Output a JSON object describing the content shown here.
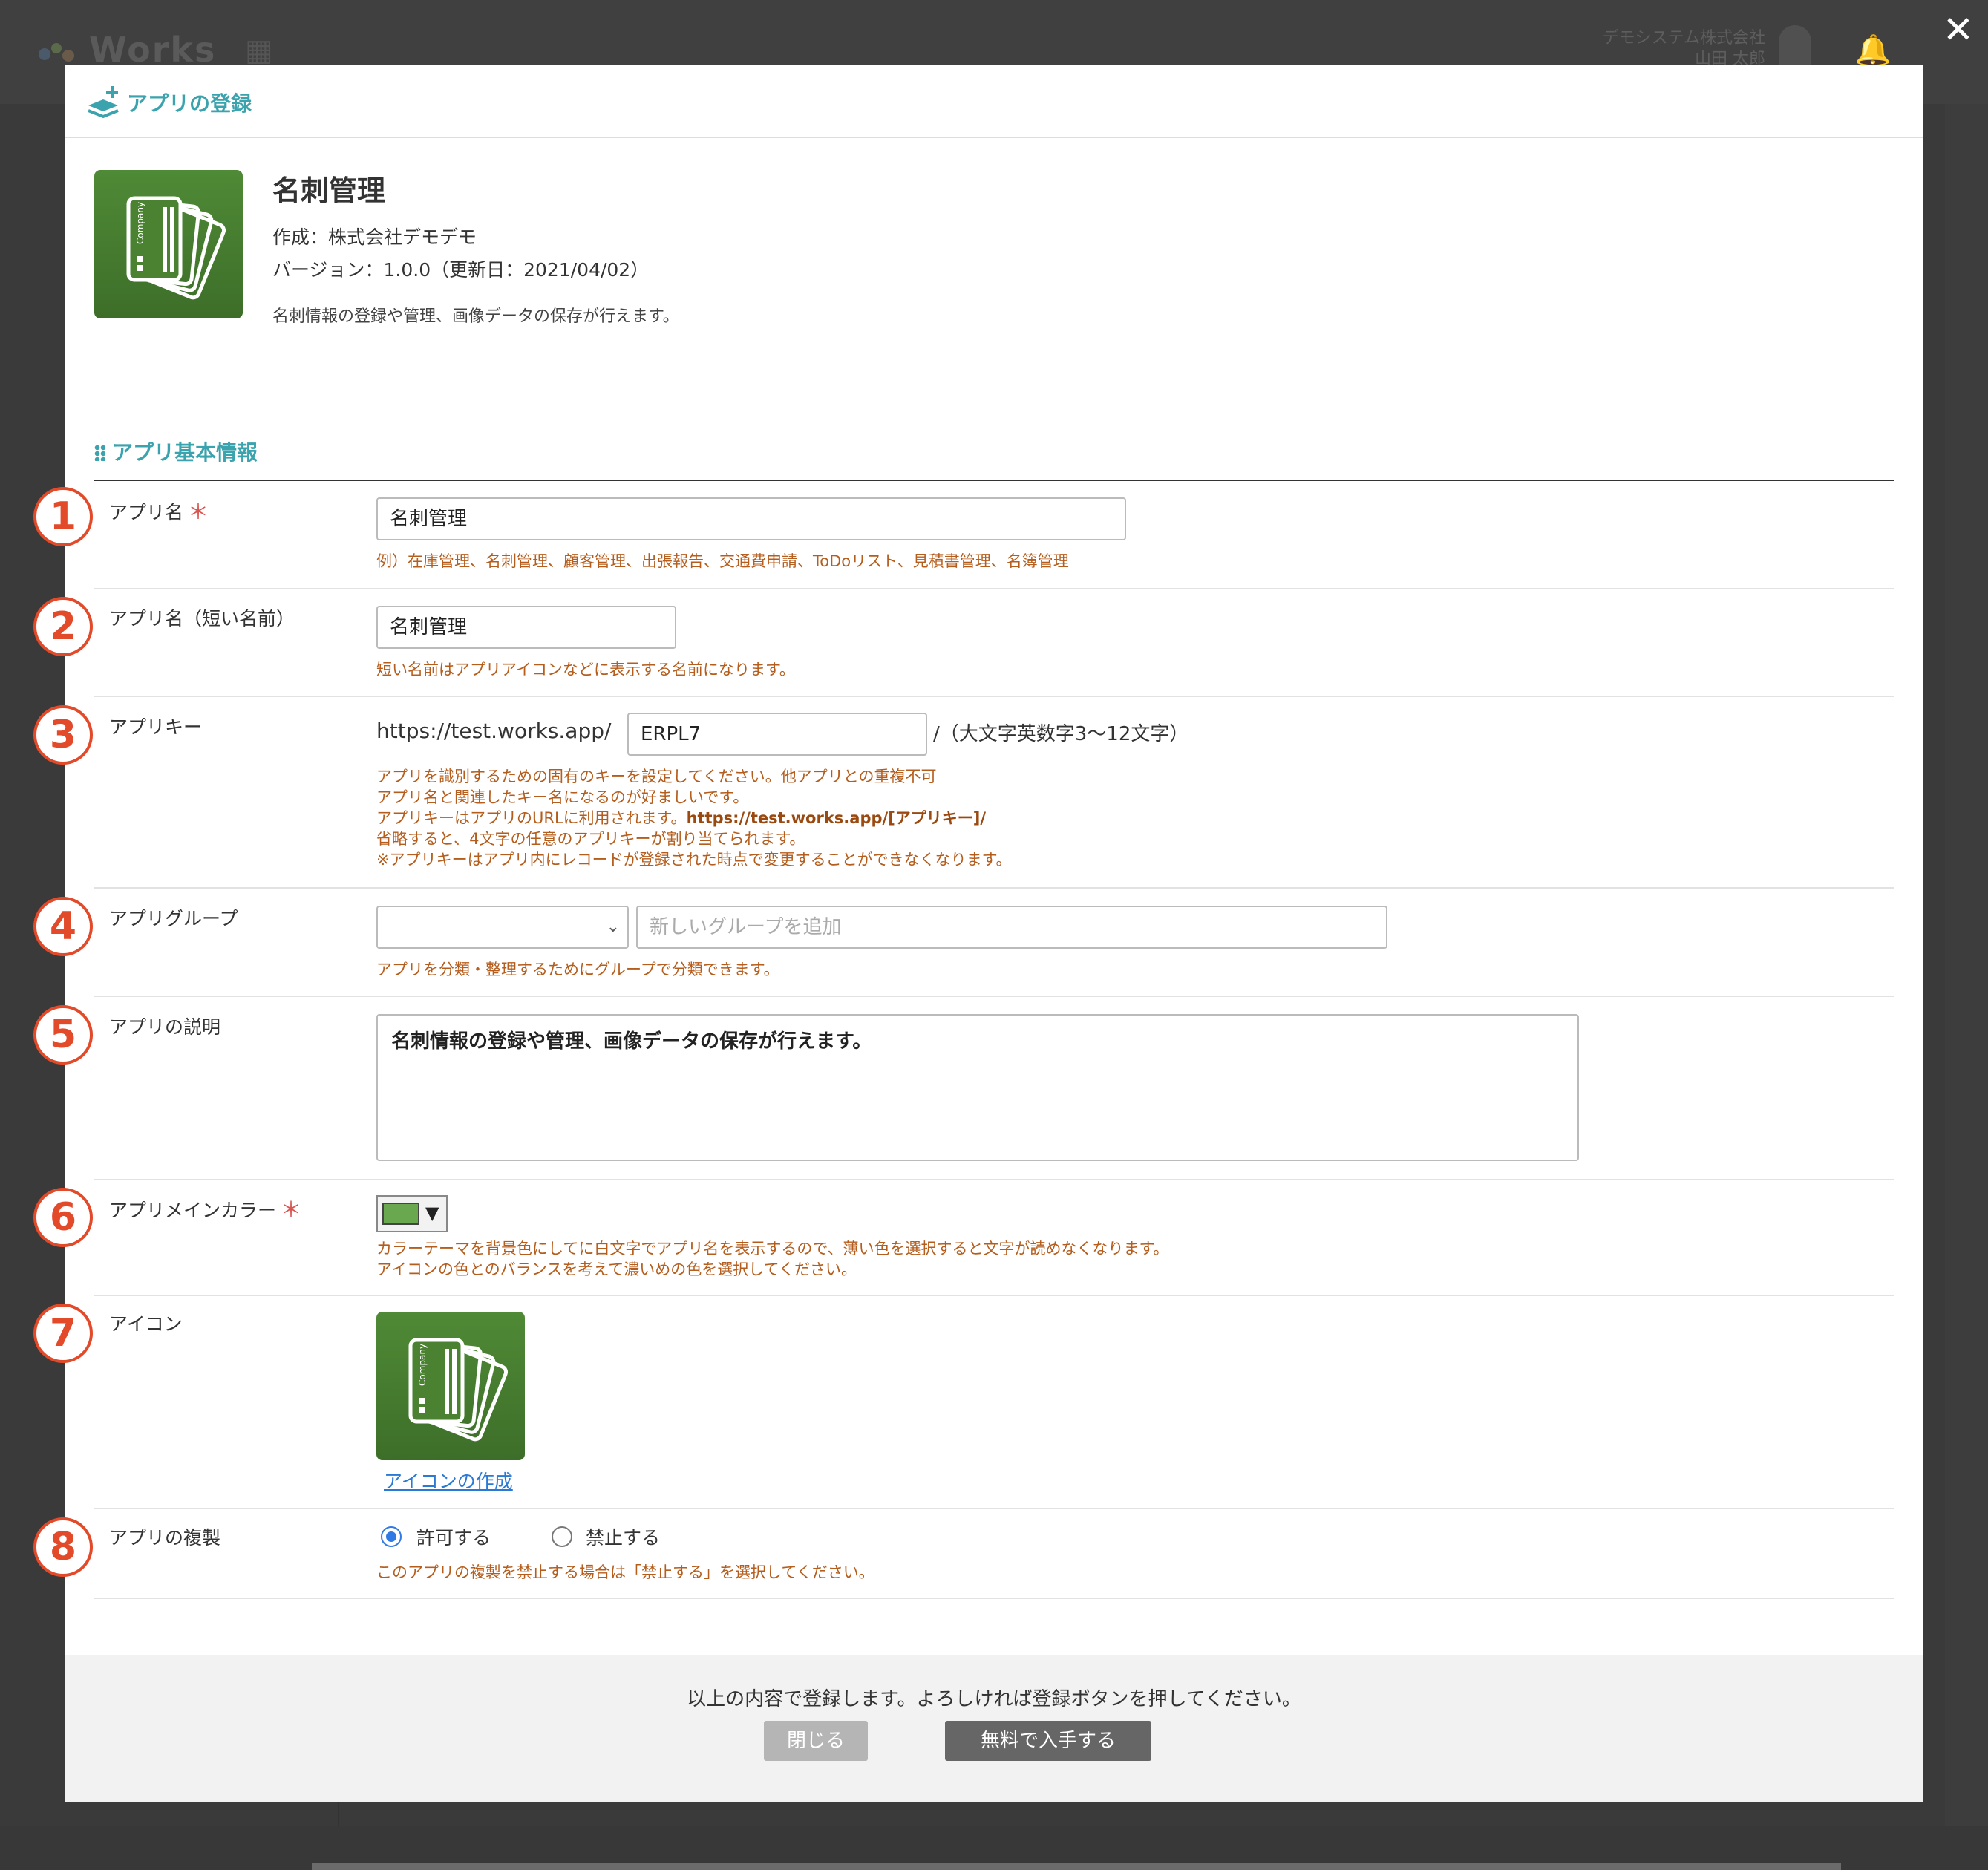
{
  "background": {
    "logo_text": "Works",
    "company_name": "デモシステム株式会社",
    "user_name": "山田 太郎"
  },
  "modal": {
    "title": "アプリの登録",
    "close_label": "✕"
  },
  "app": {
    "name": "名刺管理",
    "author": "作成：株式会社デモデモ",
    "version": "バージョン：1.0.0（更新日：2021/04/02）",
    "description": "名刺情報の登録や管理、画像データの保存が行えます。",
    "icon_color": "#4f8a36"
  },
  "section": {
    "title": "アプリ基本情報"
  },
  "fields": {
    "app_name": {
      "badge": "1",
      "label": "アプリ名",
      "required_mark": "＊",
      "value": "名刺管理",
      "hint": "例）在庫管理、名刺管理、顧客管理、出張報告、交通費申請、ToDoリスト、見積書管理、名簿管理"
    },
    "short_name": {
      "badge": "2",
      "label": "アプリ名（短い名前）",
      "value": "名刺管理",
      "hint": "短い名前はアプリアイコンなどに表示する名前になります。"
    },
    "app_key": {
      "badge": "3",
      "label": "アプリキー",
      "url_prefix": "https://test.works.app/",
      "value": "ERPL7",
      "suffix": "/（大文字英数字3〜12文字）",
      "hint_lines": [
        "アプリを識別するための固有のキーを設定してください。他アプリとの重複不可",
        "アプリ名と関連したキー名になるのが好ましいです。",
        "アプリキーはアプリのURLに利用されます。",
        "https://test.works.app/[アプリキー]/",
        "省略すると、4文字の任意のアプリキーが割り当てられます。",
        "※アプリキーはアプリ内にレコードが登録された時点で変更することができなくなります。"
      ]
    },
    "app_group": {
      "badge": "4",
      "label": "アプリグループ",
      "select_value": "",
      "new_group_placeholder": "新しいグループを追加",
      "hint": "アプリを分類・整理するためにグループで分類できます。"
    },
    "description": {
      "badge": "5",
      "label": "アプリの説明",
      "value": "名刺情報の登録や管理、画像データの保存が行えます。"
    },
    "main_color": {
      "badge": "6",
      "label": "アプリメインカラー",
      "required_mark": "＊",
      "color": "#6aa84f",
      "caret": "▼",
      "hint_lines": [
        "カラーテーマを背景色にしてに白文字でアプリ名を表示するので、薄い色を選択すると文字が読めなくなります。",
        "アイコンの色とのバランスを考えて濃いめの色を選択してください。"
      ]
    },
    "icon": {
      "badge": "7",
      "label": "アイコン",
      "link": "アイコンの作成"
    },
    "duplicate": {
      "badge": "8",
      "label": "アプリの複製",
      "options": [
        "許可する",
        "禁止する"
      ],
      "selected": "許可する",
      "hint": "このアプリの複製を禁止する場合は「禁止する」を選択してください。"
    }
  },
  "footer": {
    "message": "以上の内容で登録します。よろしければ登録ボタンを押してください。",
    "close_button": "閉じる",
    "submit_button": "無料で入手する"
  }
}
